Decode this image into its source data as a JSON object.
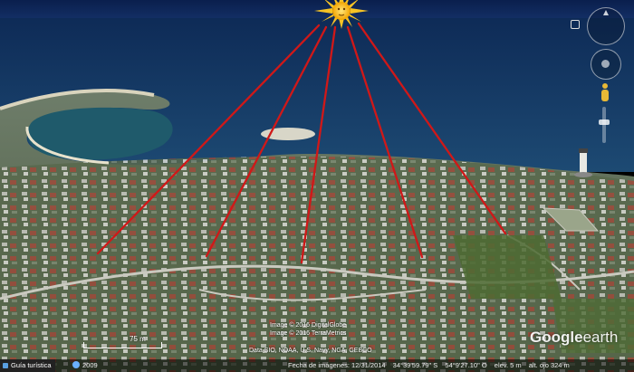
{
  "credits": {
    "line1": "Image © 2016 DigitalGlobe",
    "line2": "Image © 2016 TerraMetrics",
    "data": "Data SIO, NOAA, U.S. Navy, NGA, GEBCO"
  },
  "scale": {
    "label": "75 m"
  },
  "logo": {
    "brand": "Google",
    "product": "earth"
  },
  "statusbar": {
    "guide_label": "Guía turística",
    "year": "2009",
    "imagery_date": "Fecha de imágenes: 12/31/2014",
    "lat": "34°39'59.79\" S",
    "lon": "54°9'27.10\" O",
    "elev": "elev.   5 m",
    "eye_alt": "alt. ojo  324 m"
  },
  "colors": {
    "ray": "#d01818",
    "sun": "#f6c325",
    "sea": "#143a6b"
  },
  "icons": [
    "compass-icon",
    "look-joystick-icon",
    "pegman-icon",
    "zoom-slider",
    "sun-icon",
    "lighthouse"
  ]
}
